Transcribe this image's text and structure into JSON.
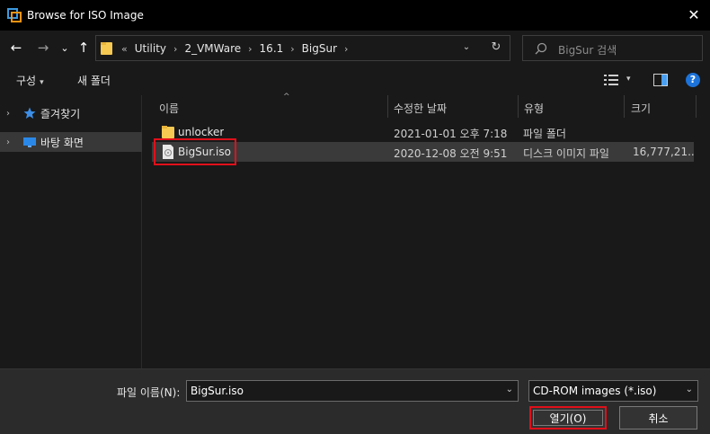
{
  "window": {
    "title": "Browse for ISO Image",
    "close_glyph": "✕"
  },
  "nav": {
    "back_glyph": "←",
    "forward_glyph": "→",
    "history_glyph": "⌄",
    "up_glyph": "↑",
    "overflow": "«",
    "breadcrumbs": [
      "Utility",
      "2_VMWare",
      "16.1",
      "BigSur"
    ],
    "separator": "›",
    "dropdown_glyph": "⌄",
    "refresh_glyph": "↻",
    "search_placeholder": "BigSur 검색"
  },
  "toolbar": {
    "organize_label": "구성",
    "organize_arrow": "▾",
    "new_folder_label": "새 폴더",
    "view_drop": "▾",
    "help_label": "?"
  },
  "navpane": {
    "items": [
      {
        "label": "즐겨찾기",
        "icon": "star-icon",
        "expander": "›",
        "selected": false
      },
      {
        "label": "바탕 화면",
        "icon": "desktop-icon",
        "expander": "›",
        "selected": true
      }
    ]
  },
  "filelist": {
    "columns": [
      "이름",
      "수정한 날짜",
      "유형",
      "크기"
    ],
    "sort_glyph": "^",
    "rows": [
      {
        "name": "unlocker",
        "modified": "2021-01-01 오후 7:18",
        "type": "파일 폴더",
        "size": "",
        "icon": "folder-icon",
        "selected": false
      },
      {
        "name": "BigSur.iso",
        "modified": "2020-12-08 오전 9:51",
        "type": "디스크 이미지 파일",
        "size": "16,777,21...",
        "icon": "disc-image-icon",
        "selected": true
      }
    ]
  },
  "bottom": {
    "filename_label": "파일 이름(N):",
    "filename_value": "BigSur.iso",
    "filetype_value": "CD-ROM images (*.iso)",
    "dropdown_glyph": "⌄",
    "open_label": "열기(O)",
    "cancel_label": "취소"
  },
  "colors": {
    "accent_highlight": "#e0101a",
    "help_blue": "#1c73d9",
    "background": "#191919"
  }
}
